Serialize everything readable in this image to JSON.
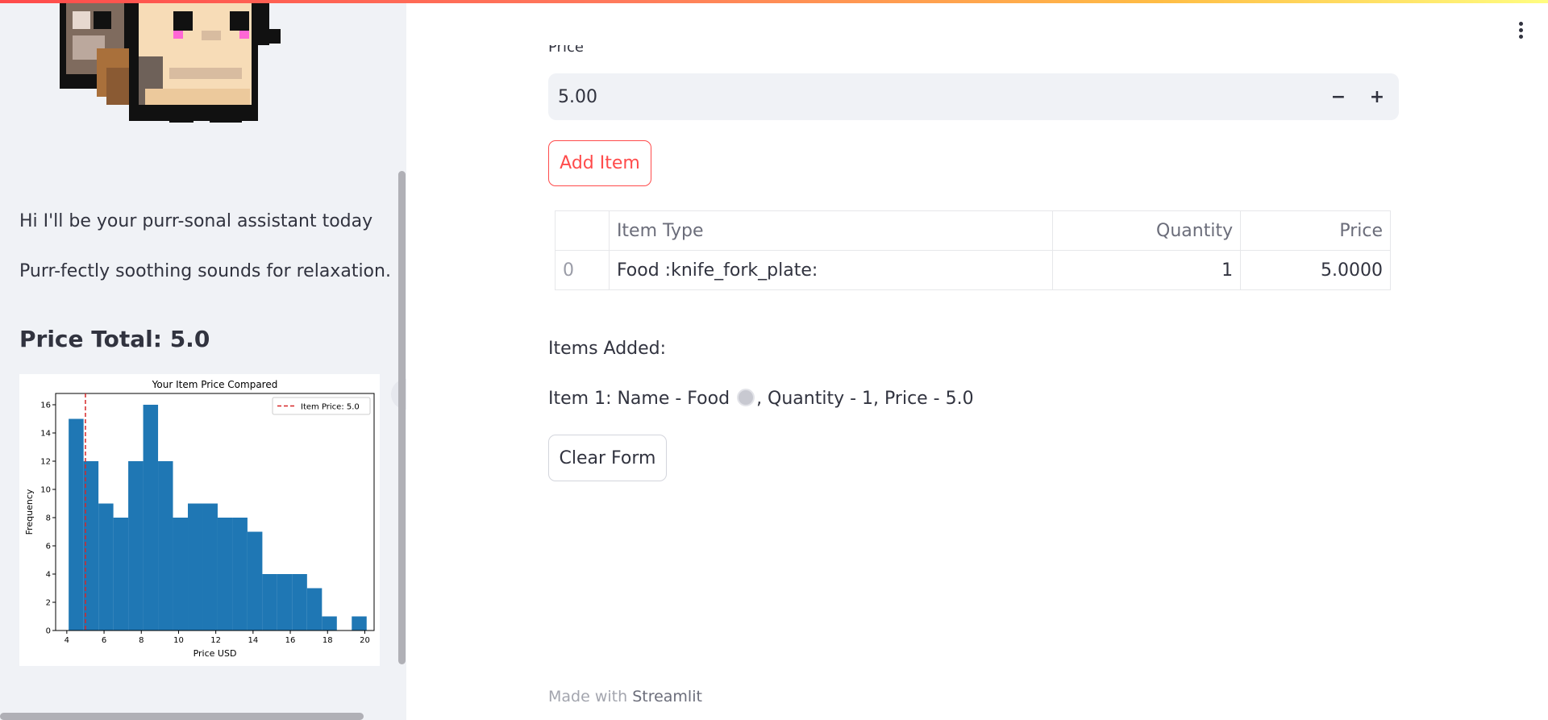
{
  "sidebar": {
    "greeting": "Hi I'll be your purr-sonal assistant today",
    "tagline": "Purr-fectly soothing sounds for relaxation.",
    "price_total": "Price Total: 5.0"
  },
  "form": {
    "price_label": "Price",
    "price_value": "5.00",
    "decrement_symbol": "−",
    "increment_symbol": "+",
    "add_button": "Add Item",
    "clear_button": "Clear Form"
  },
  "table": {
    "headers": [
      "",
      "Item Type",
      "Quantity",
      "Price"
    ],
    "rows": [
      {
        "index": "0",
        "type": "Food :knife_fork_plate:",
        "quantity": "1",
        "price": "5.0000"
      }
    ]
  },
  "items_added": {
    "heading": "Items Added:",
    "line_prefix": "Item 1: Name - Food",
    "line_suffix": ", Quantity - 1, Price - 5.0"
  },
  "footer": {
    "prefix": "Made with",
    "link": "Streamlit"
  },
  "colors": {
    "accent": "#ff4b4b",
    "bar": "#1f77b4",
    "sidebar_bg": "#f0f2f6"
  },
  "chart_data": {
    "type": "bar",
    "title": "Your Item Price Compared",
    "xlabel": "Price USD",
    "ylabel": "Frequency",
    "bins": [
      4.1,
      4.9,
      5.7,
      6.5,
      7.3,
      8.1,
      8.9,
      9.7,
      10.5,
      11.3,
      12.1,
      12.9,
      13.7,
      14.5,
      15.3,
      16.1,
      16.9,
      17.7,
      18.5,
      19.3,
      20.1
    ],
    "values": [
      15,
      12,
      9,
      8,
      12,
      16,
      12,
      8,
      9,
      9,
      8,
      8,
      7,
      4,
      4,
      4,
      3,
      1,
      0,
      1
    ],
    "xlim": [
      3.4,
      20.5
    ],
    "ylim": [
      0,
      16.8
    ],
    "xticks": [
      "4",
      "6",
      "8",
      "10",
      "12",
      "14",
      "16",
      "18",
      "20"
    ],
    "yticks": [
      "0",
      "2",
      "4",
      "6",
      "8",
      "10",
      "12",
      "14",
      "16"
    ],
    "vline": {
      "x": 5.0,
      "label": "Item Price: 5.0",
      "color": "#d62728"
    },
    "legend": "top-right"
  }
}
